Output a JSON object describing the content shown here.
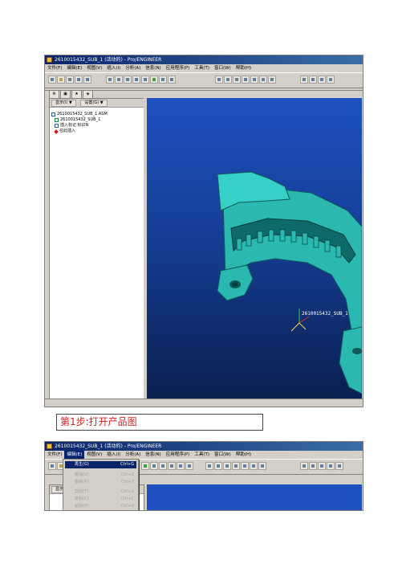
{
  "shot1": {
    "title": "2610015432_SUB_1 (活动的) - Pro/ENGINEER",
    "menu": [
      "文件(F)",
      "编辑(E)",
      "视图(V)",
      "插入(I)",
      "分析(A)",
      "信息(N)",
      "应用程序(P)",
      "工具(T)",
      "窗口(W)",
      "帮助(H)"
    ],
    "panel": {
      "show_label": "显示(I) ▼",
      "settings_label": "设置(G) ▼"
    },
    "tree": [
      {
        "label": "2610015432_SUB_1.ASM",
        "icon": "assembly-icon"
      },
      {
        "label": "2610015432_SUB_1",
        "icon": "csys-icon"
      },
      {
        "label": "插入标记 标识N",
        "icon": "feature-icon"
      },
      {
        "label": "在此插入",
        "icon": "insert-here-icon"
      }
    ],
    "model_label": "2610015432_SUB_1"
  },
  "caption": "第1步:打开产品图",
  "shot2": {
    "title": "2610015432_SUB_1 (活动的) - Pro/ENGINEER",
    "menu": [
      "文件(F)",
      "编辑(E)",
      "视图(V)",
      "插入(I)",
      "分析(A)",
      "信息(N)",
      "应用程序(P)",
      "工具(T)",
      "窗口(W)",
      "帮助(H)"
    ],
    "active_menu": "编辑(E)",
    "panel_label": "显示(I)",
    "dropdown": [
      {
        "label": "再生(G)",
        "shortcut": "Ctrl+G",
        "state": "highlighted"
      },
      {
        "label": "撤消(U)",
        "shortcut": "Ctrl+Z",
        "state": "disabled"
      },
      {
        "label": "重做(R)",
        "shortcut": "Ctrl+Y",
        "state": "disabled"
      },
      {
        "label": "剪切(T)",
        "shortcut": "Ctrl+X",
        "state": "disabled"
      },
      {
        "label": "复制(C)",
        "shortcut": "Ctrl+C",
        "state": "disabled"
      },
      {
        "label": "粘贴(P)",
        "shortcut": "Ctrl+V",
        "state": "disabled"
      }
    ]
  },
  "colors": {
    "viewport_top": "#1e50c0",
    "viewport_bottom": "#0a2050",
    "model": "#2ab8b0",
    "caption_text": "#d62020"
  }
}
